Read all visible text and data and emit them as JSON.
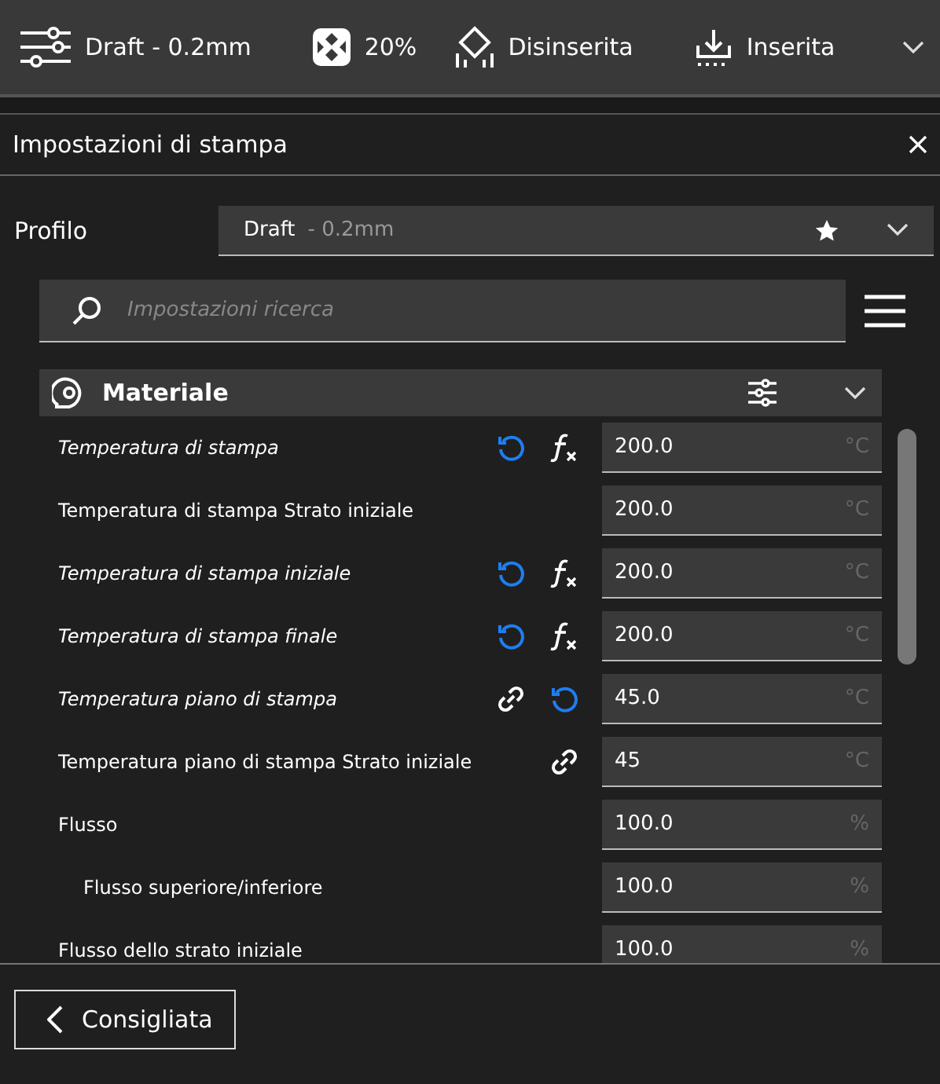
{
  "toolbar": {
    "items": [
      {
        "kind": "profile",
        "label": "Draft - 0.2mm"
      },
      {
        "kind": "infill",
        "label": "20%"
      },
      {
        "kind": "support",
        "label": "Disinserita"
      },
      {
        "kind": "adhesion",
        "label": "Inserita"
      }
    ]
  },
  "panel": {
    "title": "Impostazioni di stampa",
    "profile": {
      "label": "Profilo",
      "name": "Draft",
      "detail": "- 0.2mm"
    },
    "search": {
      "placeholder": "Impostazioni ricerca"
    },
    "category": {
      "title": "Materiale",
      "expanded": true
    },
    "settings": [
      {
        "label": "Temperatura di stampa",
        "modified": true,
        "child": false,
        "icons": [
          {
            "kind": "reset"
          },
          {
            "kind": "formula"
          }
        ],
        "value": "200.0",
        "unit": "°C"
      },
      {
        "label": "Temperatura di stampa Strato iniziale",
        "modified": false,
        "child": false,
        "value": "200.0",
        "unit": "°C"
      },
      {
        "label": "Temperatura di stampa iniziale",
        "modified": true,
        "child": false,
        "icons": [
          {
            "kind": "reset"
          },
          {
            "kind": "formula"
          }
        ],
        "value": "200.0",
        "unit": "°C"
      },
      {
        "label": "Temperatura di stampa finale",
        "modified": true,
        "child": false,
        "icons": [
          {
            "kind": "reset"
          },
          {
            "kind": "formula"
          }
        ],
        "value": "200.0",
        "unit": "°C"
      },
      {
        "label": "Temperatura piano di stampa",
        "modified": true,
        "child": false,
        "icons": [
          {
            "kind": "link"
          },
          {
            "kind": "reset"
          }
        ],
        "value": "45.0",
        "unit": "°C"
      },
      {
        "label": "Temperatura piano di stampa Strato iniziale",
        "modified": false,
        "child": false,
        "icons": [
          {
            "kind": "link"
          }
        ],
        "value": "45",
        "unit": "°C"
      },
      {
        "label": "Flusso",
        "modified": false,
        "child": false,
        "value": "100.0",
        "unit": "%"
      },
      {
        "label": "Flusso superiore/inferiore",
        "modified": false,
        "child": true,
        "value": "100.0",
        "unit": "%"
      },
      {
        "label": "Flusso dello strato iniziale",
        "modified": false,
        "child": false,
        "value": "100.0",
        "unit": "%"
      }
    ],
    "footer": {
      "button": "Consigliata"
    }
  }
}
